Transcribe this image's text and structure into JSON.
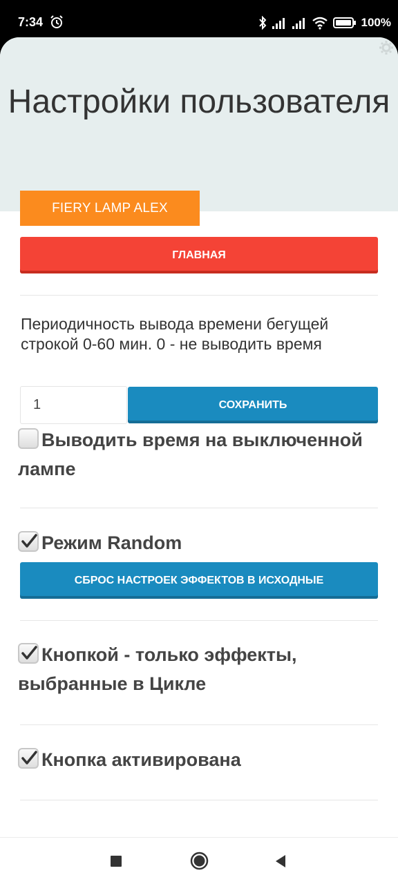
{
  "status_bar": {
    "time": "7:34",
    "battery": "100%"
  },
  "header": {
    "title": "Настройки пользователя"
  },
  "lamp_name": "FIERY LAMP ALEX",
  "main_button": "ГЛАВНАЯ",
  "time_interval": {
    "description": "Периодичность вывода времени бегущей строкой 0-60 мин. 0 - не выводить время",
    "value": "1",
    "save_button": "СОХРАНИТЬ"
  },
  "checkboxes": {
    "show_time_off": {
      "label": "Выводить время на выключенной лампе",
      "checked": false
    },
    "random_mode": {
      "label": "Режим Random",
      "checked": true
    },
    "button_cycle": {
      "label": "Кнопкой - только эффекты, выбранные в Цикле",
      "checked": true
    },
    "button_active": {
      "label": "Кнопка активирована",
      "checked": true
    }
  },
  "reset_button": "СБРОС НАСТРОЕК ЭФФЕКТОВ В ИСХОДНЫЕ",
  "colors": {
    "accent_orange": "#fb8b1e",
    "danger_red": "#f44336",
    "primary_blue": "#1a8bbf",
    "header_bg": "#e6eeee"
  }
}
